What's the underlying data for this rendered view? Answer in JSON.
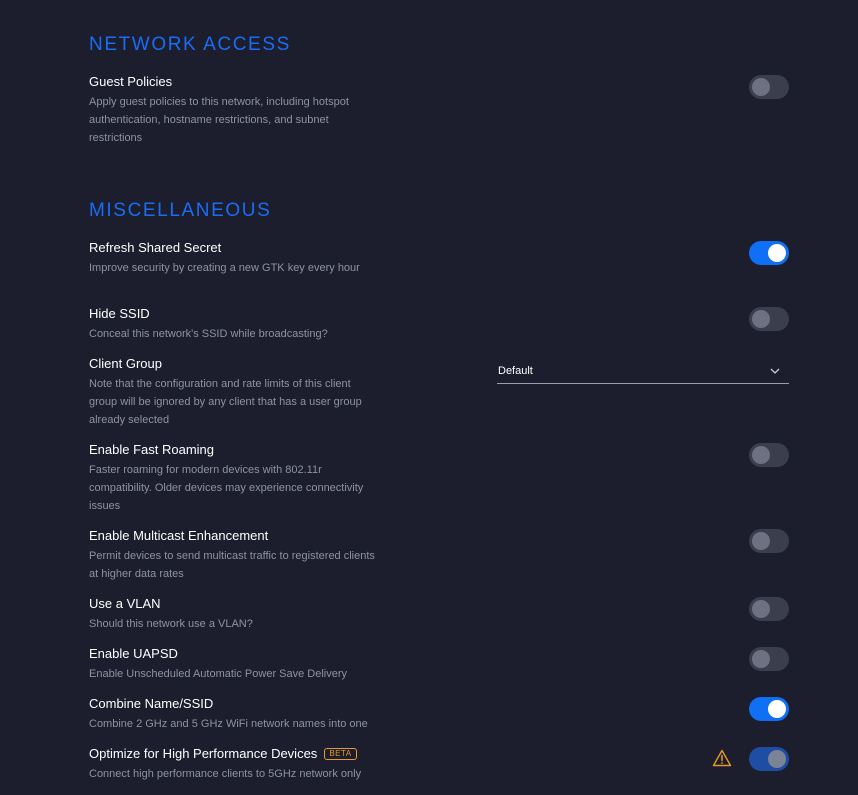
{
  "network_access": {
    "title": "NETWORK ACCESS",
    "guest_policies": {
      "title": "Guest Policies",
      "description": "Apply guest policies to this network, including hotspot authentication, hostname restrictions, and subnet restrictions",
      "enabled": false
    }
  },
  "misc": {
    "title": "MISCELLANEOUS",
    "refresh_shared_secret": {
      "title": "Refresh Shared Secret",
      "description": "Improve security by creating a new GTK key every hour",
      "enabled": true
    },
    "hide_ssid": {
      "title": "Hide SSID",
      "description": "Conceal this network's SSID while broadcasting?",
      "enabled": false
    },
    "client_group": {
      "title": "Client Group",
      "description": "Note that the configuration and rate limits of this client group will be ignored by any client that has a user group already selected",
      "selected": "Default"
    },
    "fast_roaming": {
      "title": "Enable Fast Roaming",
      "description": "Faster roaming for modern devices with 802.11r compatibility. Older devices may experience connectivity issues",
      "enabled": false
    },
    "multicast_enhancement": {
      "title": "Enable Multicast Enhancement",
      "description": "Permit devices to send multicast traffic to registered clients at higher data rates",
      "enabled": false
    },
    "use_vlan": {
      "title": "Use a VLAN",
      "description": "Should this network use a VLAN?",
      "enabled": false
    },
    "uapsd": {
      "title": "Enable UAPSD",
      "description": "Enable Unscheduled Automatic Power Save Delivery",
      "enabled": false
    },
    "combine_name_ssid": {
      "title": "Combine Name/SSID",
      "description": "Combine 2 GHz and 5 GHz WiFi network names into one",
      "enabled": true
    },
    "high_performance": {
      "title": "Optimize for High Performance Devices",
      "badge": "BETA",
      "description": "Connect high performance clients to 5GHz network only",
      "enabled": true,
      "icon": "warning-icon"
    }
  },
  "colors": {
    "background": "#1c1e2d",
    "accent": "#1a6cf5",
    "toggle_on": "#0f6ff5",
    "toggle_off": "#3b3e4d",
    "badge": "#e69a28",
    "muted_text": "#8e92a3"
  }
}
